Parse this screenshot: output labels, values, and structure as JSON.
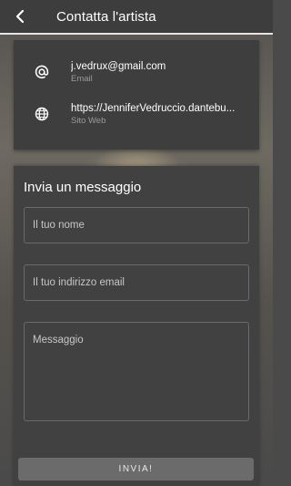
{
  "header": {
    "title": "Contatta l'artista",
    "back_icon": "chevron-left-icon"
  },
  "contacts": [
    {
      "icon": "at-icon",
      "value": "j.vedrux@gmail.com",
      "label": "Email"
    },
    {
      "icon": "globe-icon",
      "value": "https://JenniferVedruccio.dantebu...",
      "label": "Sito Web"
    }
  ],
  "form": {
    "title": "Invia un messaggio",
    "name_placeholder": "Il tuo nome",
    "email_placeholder": "Il tuo indirizzo email",
    "message_placeholder": "Messaggio",
    "submit_label": "INVIA!"
  },
  "colors": {
    "app_bar": "#3d3d3d",
    "card": "#3e3e3e",
    "panel": "#414141",
    "button": "#6b6b6b"
  }
}
